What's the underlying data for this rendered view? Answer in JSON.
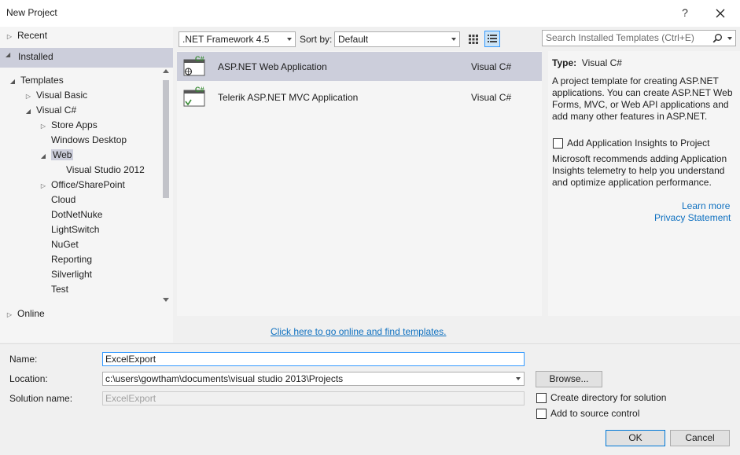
{
  "window": {
    "title": "New Project",
    "help_label": "?"
  },
  "sidebar": {
    "recent": "Recent",
    "installed": "Installed",
    "online": "Online",
    "tree": [
      {
        "label": "Templates"
      },
      {
        "label": "Visual Basic"
      },
      {
        "label": "Visual C#"
      },
      {
        "label": "Store Apps"
      },
      {
        "label": "Windows Desktop"
      },
      {
        "label": "Web"
      },
      {
        "label": "Visual Studio 2012"
      },
      {
        "label": "Office/SharePoint"
      },
      {
        "label": "Cloud"
      },
      {
        "label": "DotNetNuke"
      },
      {
        "label": "LightSwitch"
      },
      {
        "label": "NuGet"
      },
      {
        "label": "Reporting"
      },
      {
        "label": "Silverlight"
      },
      {
        "label": "Test"
      }
    ]
  },
  "toolbar": {
    "framework": ".NET Framework 4.5",
    "sort_label": "Sort by:",
    "sort_value": "Default",
    "search_placeholder": "Search Installed Templates (Ctrl+E)"
  },
  "templates": [
    {
      "name": "ASP.NET Web Application",
      "language": "Visual C#",
      "icon_badge": "C#",
      "selected": true
    },
    {
      "name": "Telerik ASP.NET MVC Application",
      "language": "Visual C#",
      "icon_badge": "C#",
      "selected": false
    }
  ],
  "description": {
    "type_label": "Type:",
    "type_value": "Visual C#",
    "text": "A project template for creating ASP.NET applications. You can create ASP.NET Web Forms, MVC,  or Web API applications and add many other features in ASP.NET.",
    "ai_checkbox_label": "Add Application Insights to Project",
    "ai_text": "Microsoft recommends adding Application Insights telemetry to help you understand and optimize application performance.",
    "learn_more": "Learn more",
    "privacy": "Privacy Statement"
  },
  "online_link": "Click here to go online and find templates.",
  "form": {
    "name_label": "Name:",
    "name_value": "ExcelExport",
    "location_label": "Location:",
    "location_value": "c:\\users\\gowtham\\documents\\visual studio 2013\\Projects",
    "solution_label": "Solution name:",
    "solution_value": "ExcelExport",
    "browse": "Browse...",
    "create_dir": "Create directory for solution",
    "source_control": "Add to source control",
    "ok": "OK",
    "cancel": "Cancel"
  },
  "colors": {
    "selection": "#cccedb",
    "link": "#0e70c0",
    "accent": "#3399ff"
  }
}
